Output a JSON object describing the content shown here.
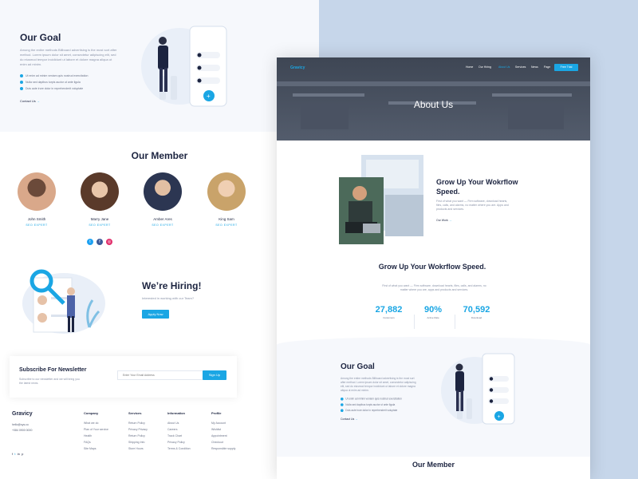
{
  "left": {
    "goal": {
      "title": "Our Goal",
      "text": "Among the entire methods Billboard advertising is the most sort after method. Lorem ipsum dolor sit amet, consectetur adipiscing elit, sed do eiusmod tempor incididunt ut labore et dolore magna aliqua ut enim ad minim.",
      "checks": [
        "Ut enim ad minim veniam quis nostrud exercitation",
        "Nulla sed dapibus turpis auctor ut ante ligula",
        "Duis aute irure dolor in reprehenderit voluptate"
      ],
      "link": "Contact Us"
    },
    "members": {
      "title": "Our Member",
      "items": [
        {
          "name": "John Smith",
          "role": "SEO EXPERT"
        },
        {
          "name": "Marry Jane",
          "role": "SEO EXPERT"
        },
        {
          "name": "Amber Ares",
          "role": "SEO EXPERT"
        },
        {
          "name": "King Sam",
          "role": "SEO EXPERT"
        }
      ]
    },
    "hiring": {
      "title": "We’re Hiring!",
      "text": "Interested in working with our Team?",
      "button": "Apply Now"
    },
    "newsletter": {
      "title": "Subscribe For Newsletter",
      "text": "Subscribe to our newsletter and we will bring you the latest news.",
      "placeholder": "Enter Your Email Address",
      "button": "Sign Up"
    },
    "footer": {
      "brand": "Gravicy",
      "email": "hello@sys.co",
      "phone": "+084 0900 0000",
      "cols": [
        {
          "head": "Company",
          "items": [
            "What we do",
            "Plan of Your service",
            "Health",
            "FAQs",
            "Site Maps"
          ]
        },
        {
          "head": "Services",
          "items": [
            "Return Policy",
            "Privacy Privacy",
            "Return Policy",
            "Shipping Info",
            "Store Hours"
          ]
        },
        {
          "head": "Information",
          "items": [
            "About Us",
            "Careers",
            "Track Chart",
            "Privacy Policy",
            "Terms & Condition"
          ]
        },
        {
          "head": "Profile",
          "items": [
            "My Account",
            "Wishlist",
            "Appointment",
            "Checkout",
            "Responsible supply"
          ]
        }
      ]
    }
  },
  "right": {
    "brand": "Gravicy",
    "nav": [
      "Home",
      "Our Hiring",
      "About Us",
      "Services",
      "News",
      "Page"
    ],
    "nav_button": "Free Trial",
    "hero_title": "About Us",
    "grow": {
      "title": "Grow Up Your Wokrflow Speed.",
      "text": "First of what you want — Firm software, download hearts, files, calls, and alarms, no matter where you are. Apps and products and services.",
      "link": "Our Work"
    },
    "grow2": {
      "title": "Grow Up Your Wokrflow Speed.",
      "text": "First of what you want — Firm software, download hearts, files, calls, and alarms, no matter where you are, apps and products and services."
    },
    "stats": [
      {
        "value": "27,882",
        "label": "Customers"
      },
      {
        "value": "90%",
        "label": "Active Rate"
      },
      {
        "value": "70,592",
        "label": "Download"
      }
    ],
    "goal": {
      "title": "Our Goal",
      "text": "Among the entire methods Billboard advertising is the most sort after method. Lorem ipsum dolor sit amet, consectetur adipiscing elit, sed do eiusmod tempor incididunt ut labore et dolore magna aliqua ut enim ad minim.",
      "checks": [
        "Ut enim ad minim veniam quis nostrud exercitation",
        "Nulla sed dapibus turpis auctor ut ante ligula",
        "Duis aute irure dolor in reprehenderit voluptate"
      ],
      "link": "Contact Us"
    },
    "members_title": "Our Member"
  },
  "colors": {
    "accent": "#1aa6e4",
    "dark": "#1c2440",
    "bg_right": "#c6d6ea"
  }
}
